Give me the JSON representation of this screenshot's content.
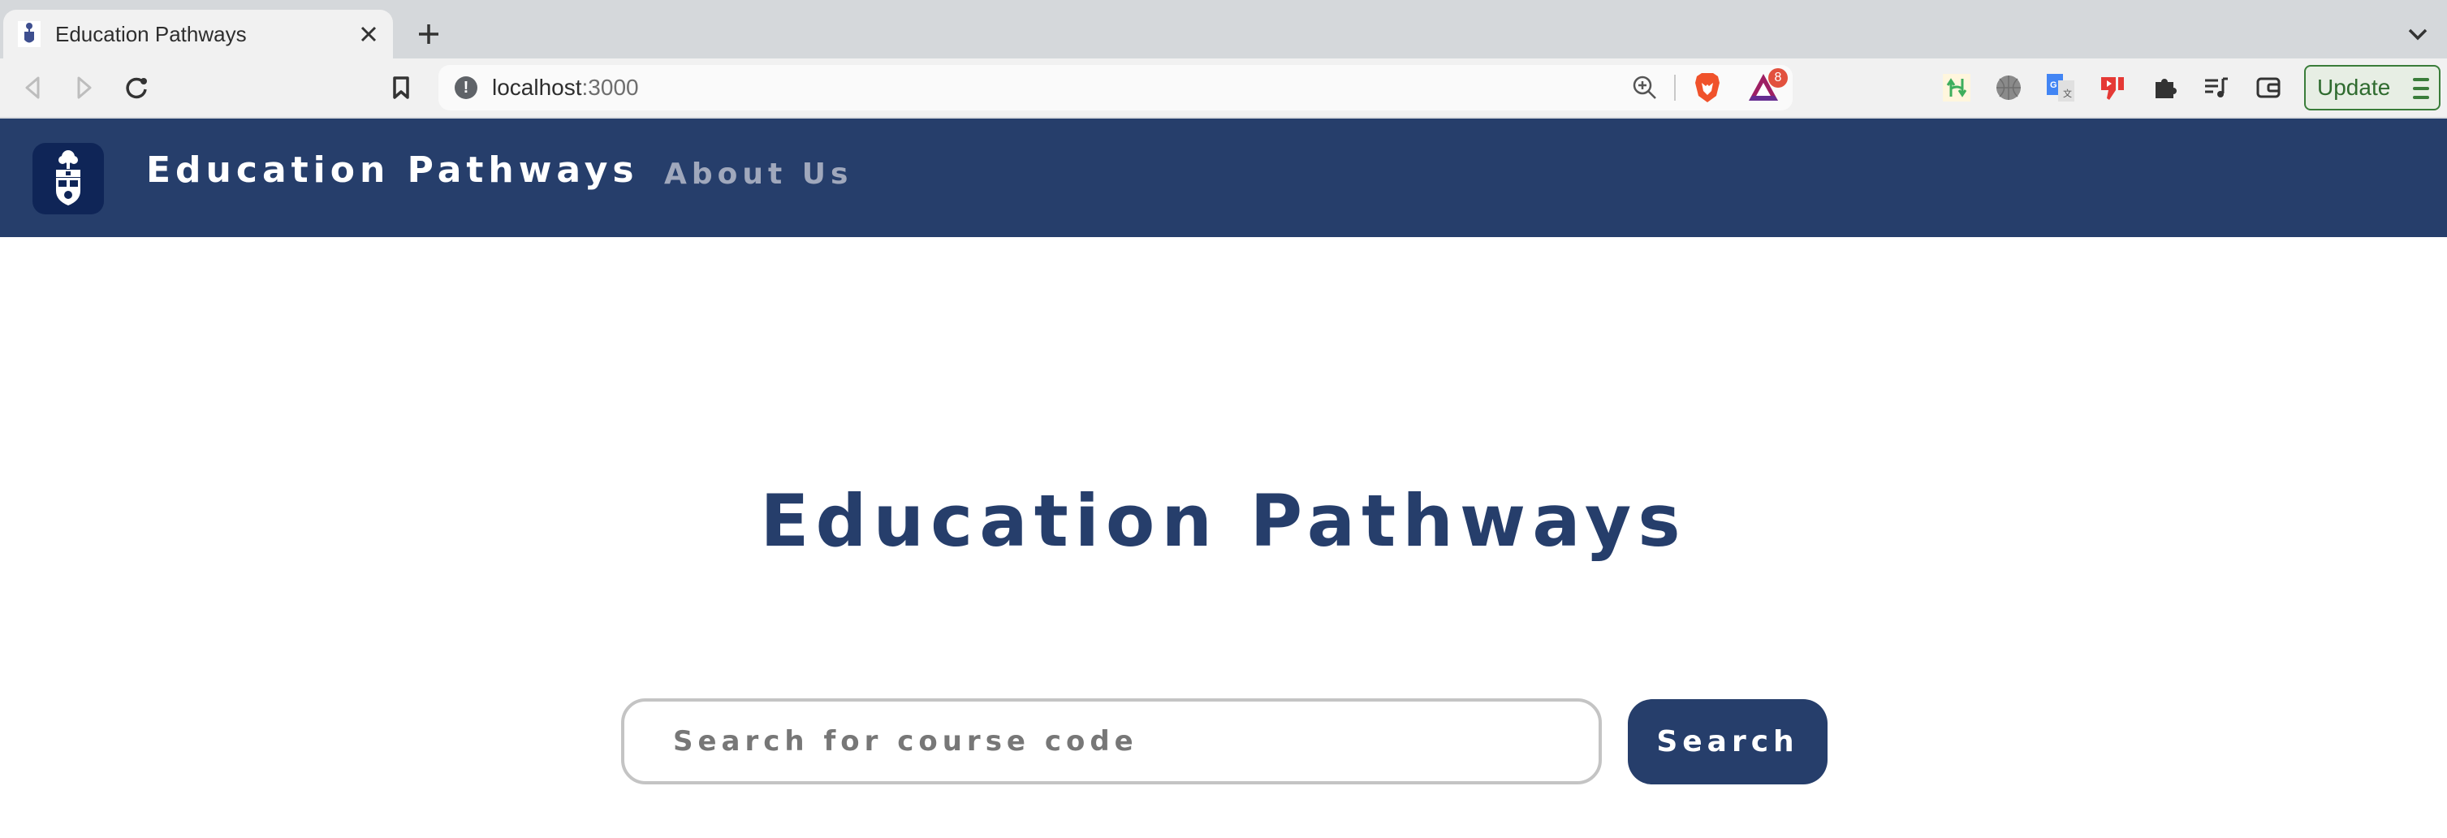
{
  "browser": {
    "tab": {
      "title": "Education Pathways",
      "favicon": "university-crest-icon",
      "close_icon": "close-icon"
    },
    "new_tab_icon": "plus-icon",
    "tab_list_icon": "chevron-down-icon",
    "toolbar": {
      "back_icon": "back-arrow-icon",
      "forward_icon": "forward-arrow-icon",
      "reload_icon": "reload-icon",
      "bookmark_icon": "bookmark-icon"
    },
    "url": {
      "host": "localhost",
      "port": ":3000",
      "security_icon": "not-secure-info-icon",
      "zoom_icon": "zoom-in-icon",
      "brave_shields_icon": "brave-lion-icon",
      "rewards_icon": "brave-rewards-icon",
      "rewards_badge": "8"
    },
    "extensions": [
      {
        "name": "tampermonkey-like-green-icon"
      },
      {
        "name": "basketball-grey-icon"
      },
      {
        "name": "google-translate-icon"
      },
      {
        "name": "red-dislike-icon"
      },
      {
        "name": "puzzle-extensions-icon"
      },
      {
        "name": "reading-list-icon"
      },
      {
        "name": "wallet-icon"
      }
    ],
    "update_button": {
      "label": "Update",
      "menu_icon": "hamburger-menu-icon"
    }
  },
  "navbar": {
    "logo": "university-crest-icon",
    "title": "Education Pathways",
    "links": [
      {
        "label": "About Us"
      }
    ],
    "colors": {
      "background": "#263E6B",
      "logo_tile": "#0F2557",
      "title": "#FFFFFF",
      "link": "#A0A8BC"
    }
  },
  "main": {
    "heading": "Education Pathways",
    "search": {
      "value": "",
      "placeholder": "Search for course code",
      "button_label": "Search"
    },
    "colors": {
      "accent": "#263E6B",
      "input_border": "#C4C4C4",
      "placeholder": "#777777"
    }
  }
}
